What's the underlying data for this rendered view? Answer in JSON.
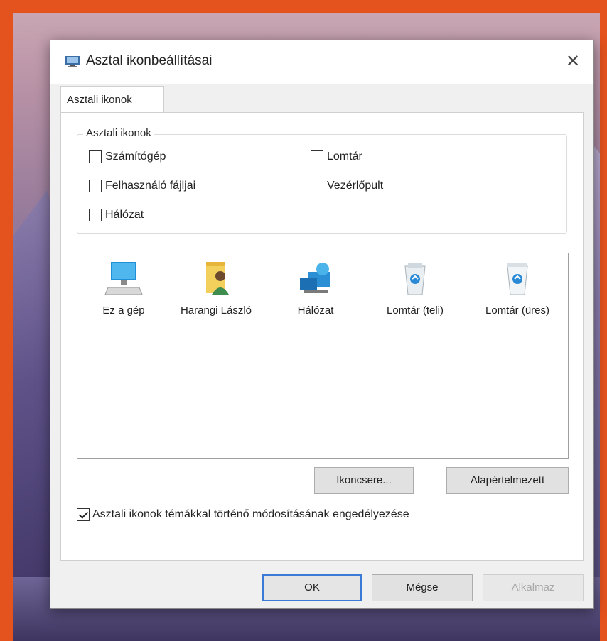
{
  "dialog": {
    "title": "Asztal ikonbeállításai",
    "close_glyph": "✕"
  },
  "tab": {
    "label": "Asztali ikonok"
  },
  "group": {
    "legend": "Asztali ikonok",
    "checkboxes": [
      {
        "label": "Számítógép",
        "checked": false
      },
      {
        "label": "Lomtár",
        "checked": false
      },
      {
        "label": "Felhasználó fájljai",
        "checked": false
      },
      {
        "label": "Vezérlőpult",
        "checked": false
      },
      {
        "label": "Hálózat",
        "checked": false
      }
    ]
  },
  "icons": [
    {
      "label": "Ez a gép",
      "icon": "computer-icon"
    },
    {
      "label": "Harangi László",
      "icon": "user-folder-icon"
    },
    {
      "label": "Hálózat",
      "icon": "network-icon"
    },
    {
      "label": "Lomtár (teli)",
      "icon": "recycle-bin-full-icon"
    },
    {
      "label": "Lomtár (üres)",
      "icon": "recycle-bin-empty-icon"
    }
  ],
  "buttons": {
    "change_icon": "Ikoncsere...",
    "restore_default": "Alapértelmezett",
    "ok": "OK",
    "cancel": "Mégse",
    "apply": "Alkalmaz"
  },
  "allow_themes": {
    "label": "Asztali ikonok témákkal történő módosításának engedélyezése",
    "checked": true
  },
  "colors": {
    "frame": "#e4521d",
    "accent_border": "#3b7ad6"
  }
}
